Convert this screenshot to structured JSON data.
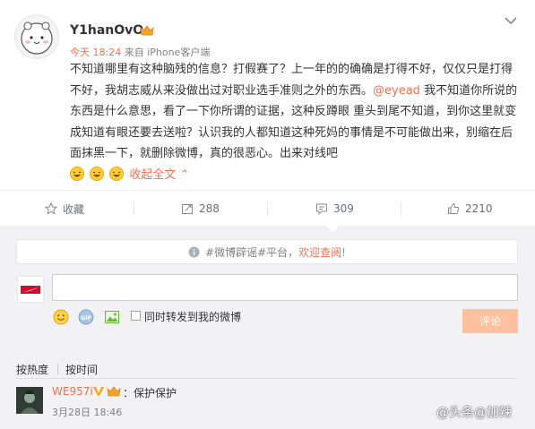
{
  "post": {
    "username": "Y1hanOvO",
    "time": "今天 18:24",
    "source": "来自 iPhone客户端",
    "paragraph_1": "不知道哪里有这种脑残的信息？打假赛了？上一年的的确确是打得不好，仅仅只是打得不好，我胡志威从来没做出过对职业选手准则之外的东西。",
    "mention": "@eyead",
    "paragraph_2": " 我不知道你所说的东西是什么意思，看了一下你所谓的证据，这种反蹲眼 重头到尾不知道，到你这里就变成知道有眼还要去送啦？认识我的人都知道这种死妈的事情是不可能做出来，别缩在后面抹黑一下，就删除微博，真的很恶心。出来对线吧",
    "collapse_label": "收起全文"
  },
  "actions": {
    "favorite_label": "收藏",
    "repost_count": "288",
    "comment_count": "309",
    "like_count": "2210"
  },
  "comment_box": {
    "notice_prefix": "#微博辟谣#平台，",
    "notice_highlight": "欢迎查阅!",
    "input_value": "",
    "repost_checkbox_label": "同时转发到我的微博",
    "submit_label": "评论"
  },
  "sort": {
    "by_hot": "按热度",
    "by_time": "按时间"
  },
  "comments": [
    {
      "user": "WE957i",
      "text": "：保护保护",
      "time": "3月28日 18:46"
    }
  ],
  "watermark": "@头条@加辣",
  "colors": {
    "accent": "#eb7350",
    "button_disabled": "#ffc09f",
    "panel_bg": "#f2f2f5"
  }
}
